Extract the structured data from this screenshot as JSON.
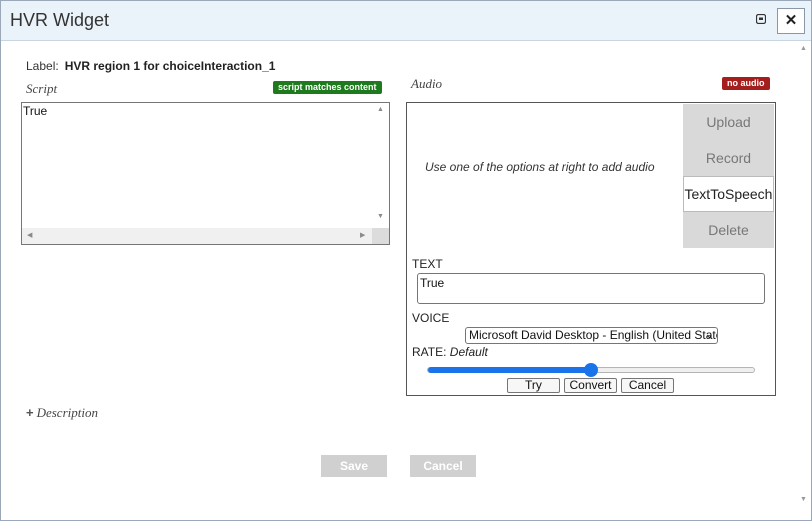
{
  "window": {
    "title": "HVR Widget",
    "close_label": "✕"
  },
  "label": {
    "key": "Label:",
    "value": "HVR region 1 for choiceInteraction_1"
  },
  "script": {
    "heading": "Script",
    "badge": "script matches content",
    "badge_color": "#1d7a1d",
    "content": "True"
  },
  "audio": {
    "heading": "Audio",
    "badge": "no audio",
    "badge_color": "#a41e1e",
    "message": "Use one of the options at right to add audio",
    "buttons": {
      "upload": "Upload",
      "record": "Record",
      "tts": "TextToSpeech",
      "delete": "Delete"
    },
    "text_label": "TEXT",
    "text_value": "True",
    "voice_label": "VOICE",
    "voice_selected": "Microsoft David Desktop - English (United States)",
    "rate_label": "RATE:",
    "rate_value": "Default",
    "rate_level": 0.5,
    "actions": {
      "try": "Try",
      "convert": "Convert",
      "cancel": "Cancel"
    },
    "accent_color": "#1a73e8"
  },
  "description": {
    "label": "Description"
  },
  "footer": {
    "save": "Save",
    "cancel": "Cancel"
  }
}
